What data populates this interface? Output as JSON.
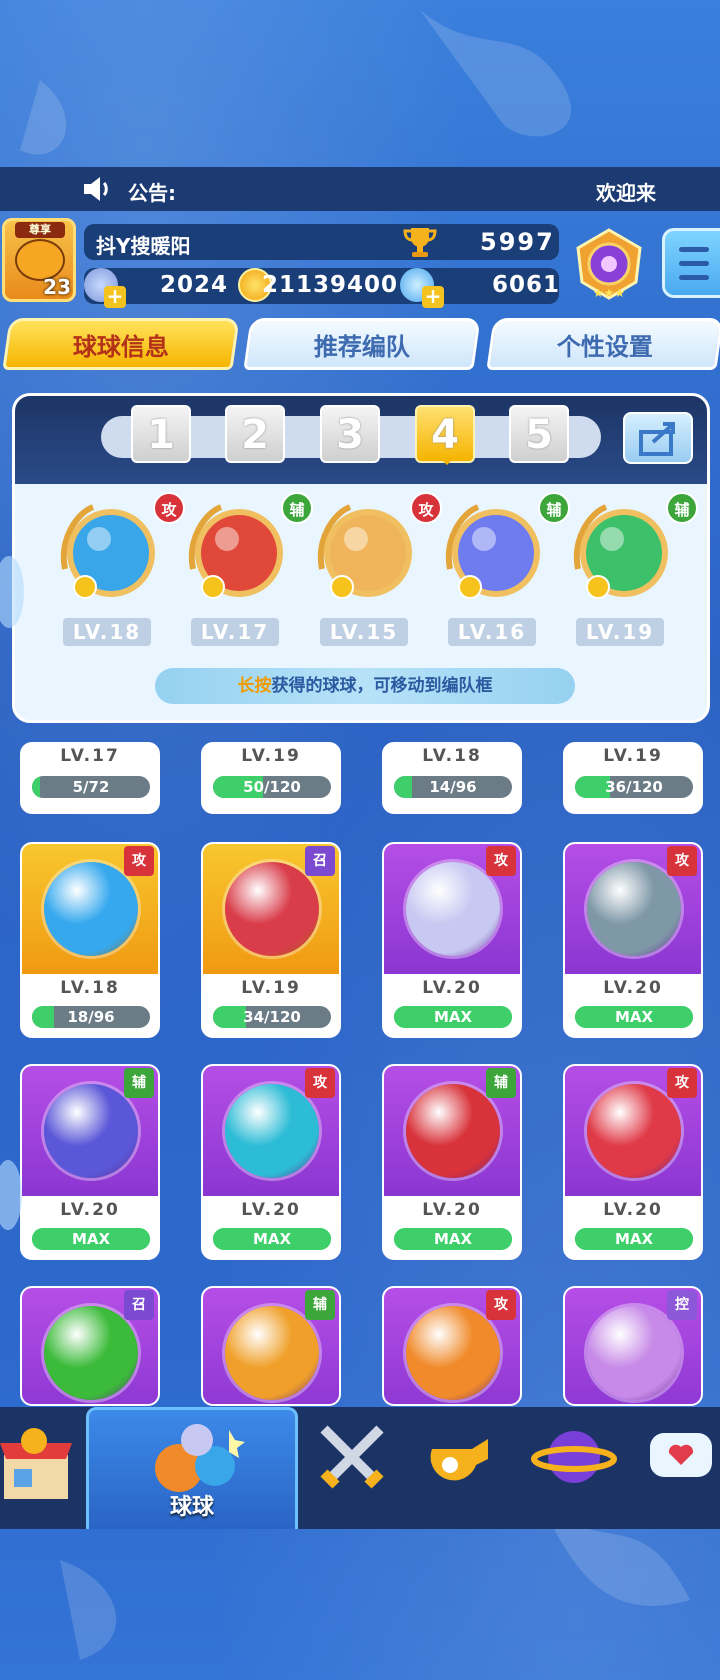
{
  "announcement": {
    "label": "公告:",
    "message": "欢迎来"
  },
  "player": {
    "avatar_tag": "尊享",
    "level": "23",
    "name": "抖Y搜暖阳",
    "trophies": "5997",
    "stat1": "2024",
    "coins": "21139400",
    "gems": "6061"
  },
  "tabs": [
    {
      "label": "球球信息"
    },
    {
      "label": "推荐编队"
    },
    {
      "label": "个性设置"
    }
  ],
  "team": {
    "slots": [
      "1",
      "2",
      "3",
      "4",
      "5"
    ],
    "selected_slot": "4",
    "members": [
      {
        "role": "攻",
        "role_type": "atk",
        "level": "LV.18",
        "color": "#3aa6ea"
      },
      {
        "role": "辅",
        "role_type": "sup",
        "level": "LV.17",
        "color": "#e0493a"
      },
      {
        "role": "攻",
        "role_type": "atk",
        "level": "LV.15",
        "color": "#f0b45a"
      },
      {
        "role": "辅",
        "role_type": "sup",
        "level": "LV.16",
        "color": "#6f7cf0"
      },
      {
        "role": "辅",
        "role_type": "sup",
        "level": "LV.19",
        "color": "#3cc06a"
      }
    ],
    "hint_strong": "长按",
    "hint_text": "获得的球球，可移动到编队框"
  },
  "grid": {
    "row0": [
      {
        "level": "LV.17",
        "progress": "5/72",
        "fill": 0.07
      },
      {
        "level": "LV.19",
        "progress": "50/120",
        "fill": 0.42
      },
      {
        "level": "LV.18",
        "progress": "14/96",
        "fill": 0.15
      },
      {
        "level": "LV.19",
        "progress": "36/120",
        "fill": 0.3
      }
    ],
    "row1": [
      {
        "role": "攻",
        "role_type": "atk",
        "level": "LV.18",
        "progress": "18/96",
        "fill": 0.19,
        "frame": "gold",
        "ball": "#35a8ee"
      },
      {
        "role": "召",
        "role_type": "sum",
        "level": "LV.19",
        "progress": "34/120",
        "fill": 0.28,
        "frame": "gold",
        "ball": "#d93d4a"
      },
      {
        "role": "攻",
        "role_type": "atk",
        "level": "LV.20",
        "progress": "MAX",
        "fill": 1,
        "frame": "purple",
        "ball": "#c7c9f2"
      },
      {
        "role": "攻",
        "role_type": "atk",
        "level": "LV.20",
        "progress": "MAX",
        "fill": 1,
        "frame": "purple",
        "ball": "#7f98a8"
      }
    ],
    "row2": [
      {
        "role": "辅",
        "role_type": "sup",
        "level": "LV.20",
        "progress": "MAX",
        "fill": 1,
        "frame": "purple",
        "ball": "#5a58d8"
      },
      {
        "role": "攻",
        "role_type": "atk",
        "level": "LV.20",
        "progress": "MAX",
        "fill": 1,
        "frame": "purple",
        "ball": "#2dbcd6"
      },
      {
        "role": "辅",
        "role_type": "sup",
        "level": "LV.20",
        "progress": "MAX",
        "fill": 1,
        "frame": "purple",
        "ball": "#d8323a"
      },
      {
        "role": "攻",
        "role_type": "atk",
        "level": "LV.20",
        "progress": "MAX",
        "fill": 1,
        "frame": "purple",
        "ball": "#e03a48"
      }
    ],
    "row3": [
      {
        "role": "召",
        "role_type": "sum",
        "frame": "purple",
        "ball": "#3cbb3a"
      },
      {
        "role": "辅",
        "role_type": "sup",
        "frame": "purple",
        "ball": "#f0a02a"
      },
      {
        "role": "攻",
        "role_type": "atk",
        "frame": "purple",
        "ball": "#f08a2a"
      },
      {
        "role": "控",
        "role_type": "ctl",
        "frame": "purple",
        "ball": "#c78ae8"
      }
    ]
  },
  "nav": {
    "active_label": "球球",
    "items": [
      "shop-icon",
      "ball-icon",
      "swords-icon",
      "whistle-icon",
      "planet-icon",
      "chat-icon"
    ]
  }
}
